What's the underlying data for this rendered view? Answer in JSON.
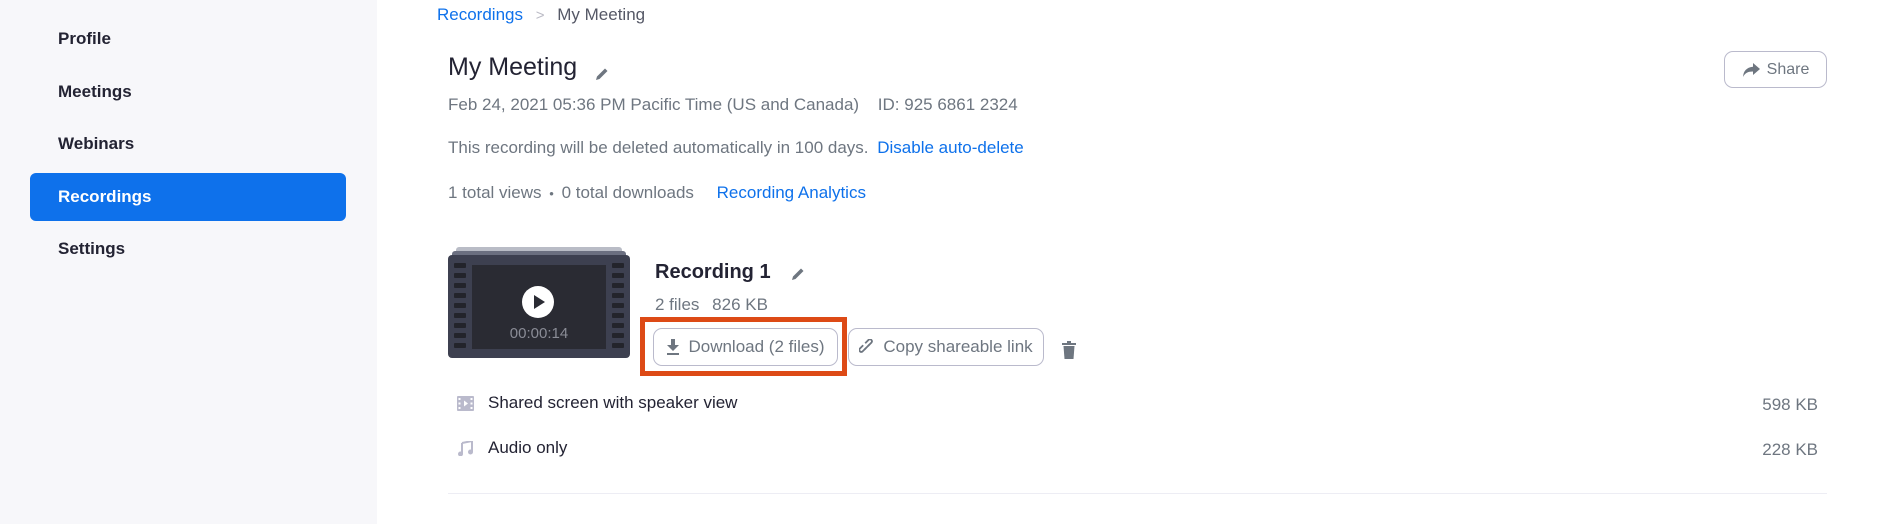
{
  "sidebar": {
    "items": [
      {
        "label": "Profile",
        "active": false
      },
      {
        "label": "Meetings",
        "active": false
      },
      {
        "label": "Webinars",
        "active": false
      },
      {
        "label": "Recordings",
        "active": true
      },
      {
        "label": "Settings",
        "active": false
      }
    ]
  },
  "breadcrumb": {
    "parent": "Recordings",
    "separator": ">",
    "current": "My Meeting"
  },
  "header": {
    "title": "My Meeting",
    "datetime": "Feb 24, 2021 05:36 PM Pacific Time (US and Canada)",
    "meeting_id": "ID: 925 6861 2324",
    "share_label": "Share"
  },
  "auto_delete": {
    "notice": "This recording will be deleted automatically in 100 days.",
    "link": "Disable auto-delete"
  },
  "stats": {
    "views": "1 total views",
    "bullet": "•",
    "downloads": "0 total downloads",
    "analytics_link": "Recording Analytics"
  },
  "recording": {
    "title": "Recording 1",
    "duration": "00:00:14",
    "file_count": "2 files",
    "total_size": "826 KB",
    "download_label": "Download (2 files)",
    "copy_link_label": "Copy shareable link",
    "files": [
      {
        "icon": "video-file-icon",
        "name": "Shared screen with speaker view",
        "size": "598 KB"
      },
      {
        "icon": "audio-file-icon",
        "name": "Audio only",
        "size": "228 KB"
      }
    ]
  },
  "colors": {
    "accent": "#0e71eb",
    "highlight": "#dd4a16",
    "sidebar_bg": "#f7f7fa"
  }
}
